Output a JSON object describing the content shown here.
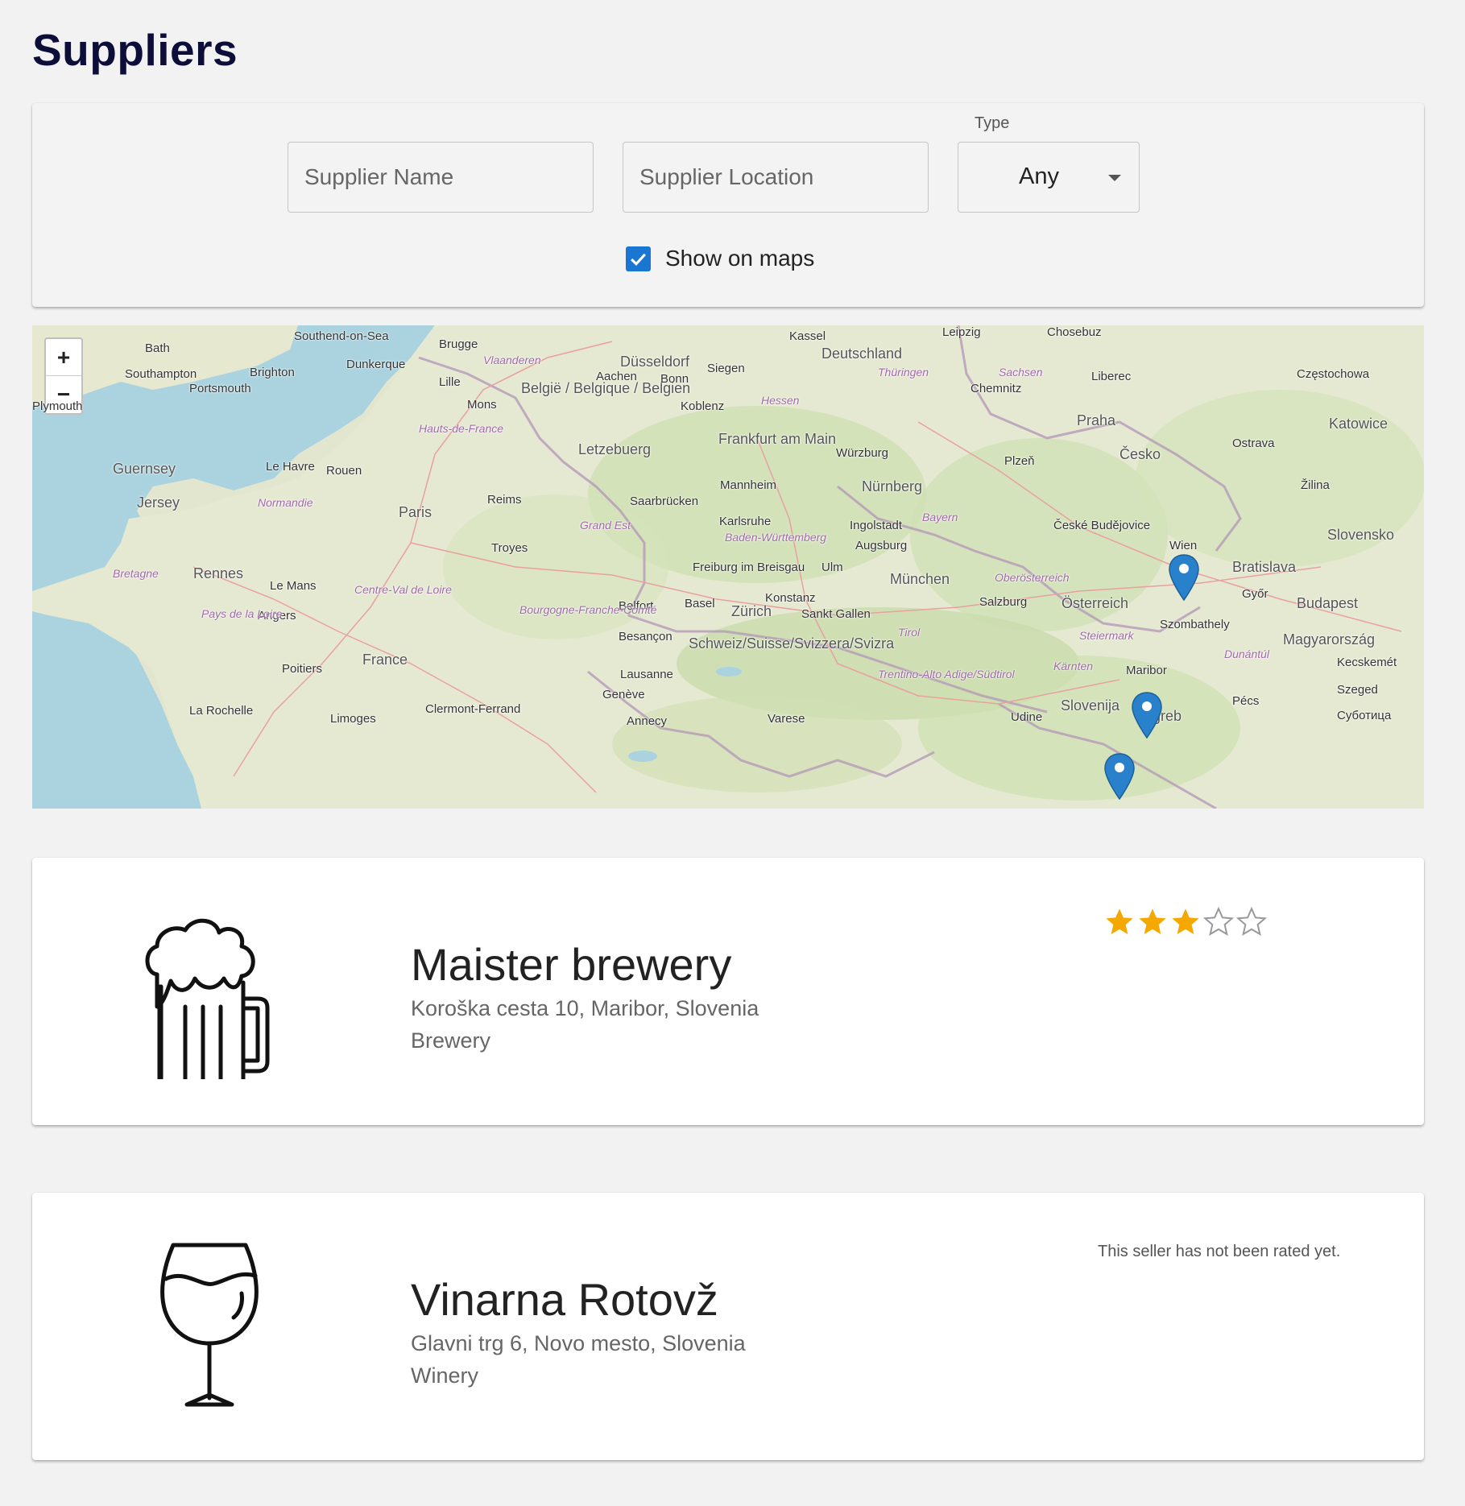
{
  "page": {
    "title": "Suppliers"
  },
  "filters": {
    "name_placeholder": "Supplier Name",
    "location_placeholder": "Supplier Location",
    "type_label": "Type",
    "type_value": "Any",
    "show_on_maps_label": "Show on maps",
    "show_on_maps_checked": true
  },
  "map": {
    "zoom_in": "+",
    "zoom_out": "−",
    "labels": [
      "Bath",
      "Southend-on-Sea",
      "Brugge",
      "Kassel",
      "Leipzig",
      "Chosebuz",
      "Southampton",
      "Brighton",
      "Dunkerque",
      "Vlaanderen",
      "Düsseldorf",
      "Siegen",
      "Deutschland",
      "Portsmouth",
      "Lille",
      "België / Belgique / Belgien",
      "Aachen",
      "Bonn",
      "Thüringen",
      "Sachsen",
      "Chemnitz",
      "Liberec",
      "Częstochowa",
      "Plymouth",
      "Mons",
      "Koblenz",
      "Hessen",
      "Praha",
      "Katowice",
      "Guernsey",
      "Le Havre",
      "Rouen",
      "Hauts-de-France",
      "Letzebuerg",
      "Frankfurt am Main",
      "Würzburg",
      "Plzeň",
      "Česko",
      "Ostrava",
      "Jersey",
      "Normandie",
      "Reims",
      "Saarbrücken",
      "Mannheim",
      "Nürnberg",
      "Žilina",
      "Paris",
      "Grand Est",
      "Karlsruhe",
      "Ingolstadt",
      "Bayern",
      "České Budějovice",
      "Troyes",
      "Baden-Württemberg",
      "Augsburg",
      "Slovensko",
      "Bretagne",
      "Rennes",
      "Freiburg im Breisgau",
      "Ulm",
      "Wien",
      "Bratislava",
      "Le Mans",
      "Centre-Val de Loire",
      "Konstanz",
      "München",
      "Oberösterreich",
      "Győr",
      "Budapest",
      "Angers",
      "Pays de la Loire",
      "Belfort",
      "Basel",
      "Zürich",
      "Sankt Gallen",
      "Salzburg",
      "Österreich",
      "Szombathely",
      "Bourgogne-Franche-Comté",
      "Besançon",
      "Schweiz/Suisse/Svizzera/Svizra",
      "Tirol",
      "Steiermark",
      "Magyarország",
      "France",
      "Poitiers",
      "Lausanne",
      "Genève",
      "Trentino-Alto Adige/Südtirol",
      "Kärnten",
      "Maribor",
      "Dunántúl",
      "Kecskemét",
      "La Rochelle",
      "Limoges",
      "Clermont-Ferrand",
      "Annecy",
      "Varese",
      "Udine",
      "Slovenija",
      "Zagreb",
      "Pécs",
      "Szeged",
      "Суботица"
    ]
  },
  "suppliers": [
    {
      "name": "Maister brewery",
      "address": "Koroška cesta 10, Maribor, Slovenia",
      "type": "Brewery",
      "icon": "beer-mug-icon",
      "rating": 3,
      "rating_max": 5
    },
    {
      "name": "Vinarna Rotovž",
      "address": "Glavni trg 6, Novo mesto, Slovenia",
      "type": "Winery",
      "icon": "wine-glass-icon",
      "rating_text": "This seller has not been rated yet."
    }
  ],
  "colors": {
    "accent": "#1976d2",
    "title": "#0d0d3a",
    "star": "#f5a800",
    "marker": "#2a81cb"
  }
}
